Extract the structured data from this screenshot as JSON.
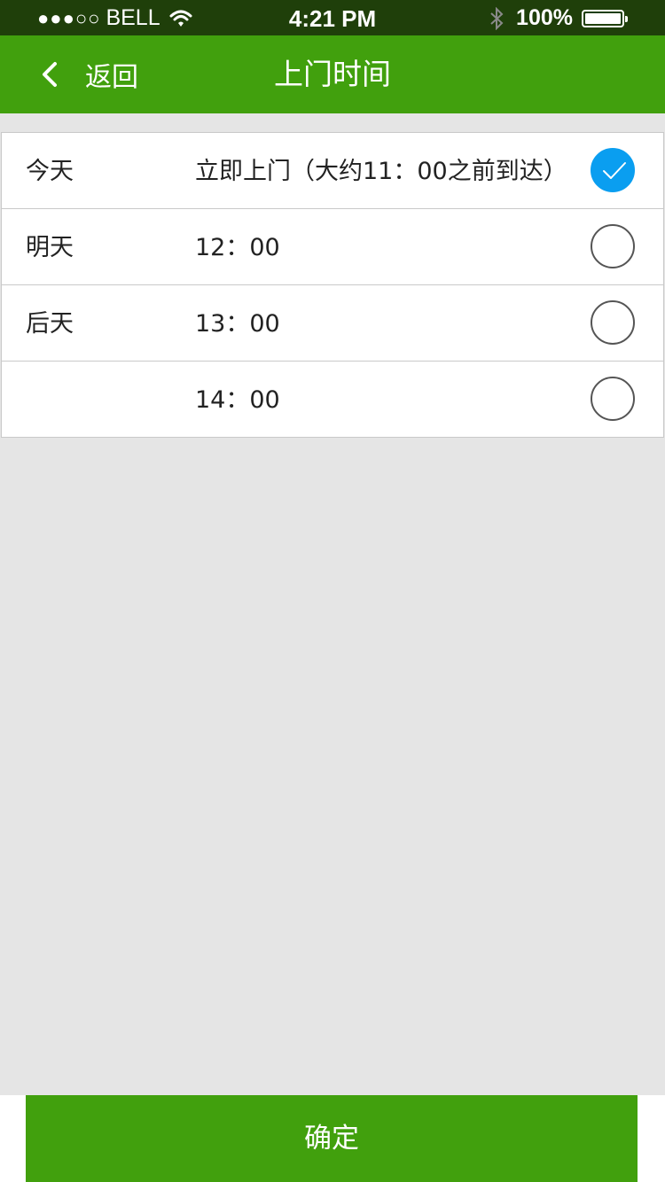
{
  "status_bar": {
    "signal": "●●●○○",
    "carrier": "BELL",
    "time": "4:21 PM",
    "battery": "100%"
  },
  "nav": {
    "back_label": "返回",
    "title": "上门时间"
  },
  "rows": [
    {
      "day": "今天",
      "slot": "立即上门（大约11：00之前到达）",
      "selected": true
    },
    {
      "day": "明天",
      "slot": "12：00",
      "selected": false
    },
    {
      "day": "后天",
      "slot": "13：00",
      "selected": false
    },
    {
      "day": "",
      "slot": "14：00",
      "selected": false
    }
  ],
  "confirm_label": "确定",
  "colors": {
    "brand_green": "#41a00d",
    "status_bar": "#1f3f0a",
    "selected_blue": "#0a9ef0",
    "background": "#e5e5e5"
  },
  "icons": [
    "wifi-icon",
    "bluetooth-icon",
    "battery-icon",
    "back-chevron-icon",
    "check-icon"
  ]
}
